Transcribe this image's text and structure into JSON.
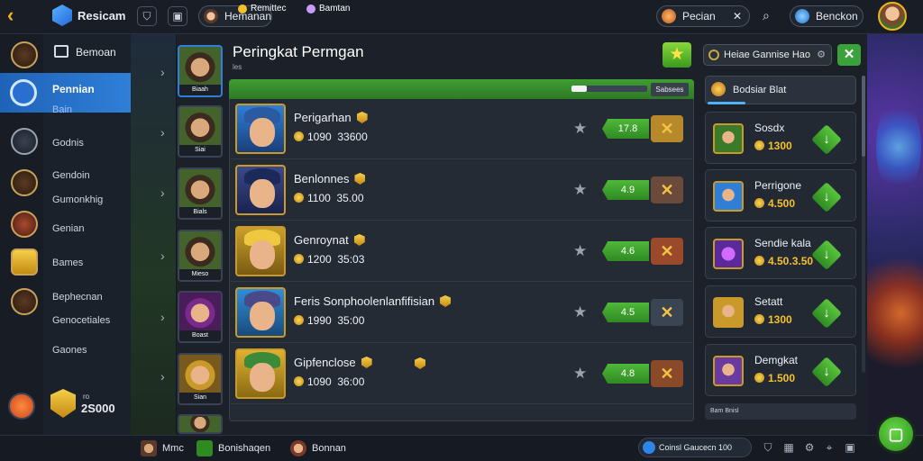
{
  "topbar": {
    "brand": "Resicam",
    "profile_pill": "Hemanan",
    "resource_pill": "Pecian",
    "resource_close": "✕",
    "account_pill": "Benckon"
  },
  "sidebar": {
    "header_label": "Bemoan",
    "active": {
      "label": "Pennian",
      "sub": "Bain"
    },
    "items": [
      {
        "label": "Godnis"
      },
      {
        "label": "Gendoin"
      },
      {
        "label": "Gumonkhig"
      },
      {
        "label": "Genian"
      },
      {
        "label": "Bames"
      },
      {
        "label": "Bephecnan"
      },
      {
        "label": "Genocetiales"
      },
      {
        "label": "Gaones"
      }
    ],
    "coins": {
      "label": "ro",
      "value": "2S000"
    }
  },
  "main": {
    "title": "Peringkat Permgan",
    "subtitle": "les",
    "filter_label": "Heiae Gannise Hao",
    "left_badges": [
      "Biaah",
      "Siai",
      "Bials",
      "Mieso",
      "Boast",
      "Sian"
    ],
    "list_header": {
      "col1": "Remittec",
      "col2": "Bamtan",
      "button": "Sabsees",
      "progress": 0.2
    },
    "rows": [
      {
        "name": "Perigarhan",
        "coins": "1090",
        "value": "33600",
        "score": "17.8"
      },
      {
        "name": "Benlonnes",
        "coins": "1100",
        "value": "35.00",
        "score": "4.9"
      },
      {
        "name": "Genroynat",
        "coins": "1200",
        "value": "35:03",
        "score": "4.6"
      },
      {
        "name": "Feris Sonphoolenlanfifisian",
        "coins": "1990",
        "value": "35:00",
        "score": "4.5"
      },
      {
        "name": "Gipfenclose",
        "coins": "1090",
        "value": "36:00",
        "score": "4.8"
      }
    ]
  },
  "right": {
    "header": "Bodsiar Blat",
    "cards": [
      {
        "name": "Sosdx",
        "price": "1300"
      },
      {
        "name": "Perrigone",
        "price": "4.500"
      },
      {
        "name": "Sendie kala",
        "price": "4.50.3.50"
      },
      {
        "name": "Setatt",
        "price": "1300"
      },
      {
        "name": "Demgkat",
        "price": "1.500"
      }
    ],
    "footer": "Bam Bnisl"
  },
  "bottom": {
    "items": [
      "Mmc",
      "Bonishaqen",
      "Bonnan"
    ],
    "status": "Coinsl Gaucecn 100"
  },
  "colors": {
    "accent_green": "#3f9d33",
    "accent_blue": "#2f7fd8",
    "gold": "#f5c12b"
  }
}
